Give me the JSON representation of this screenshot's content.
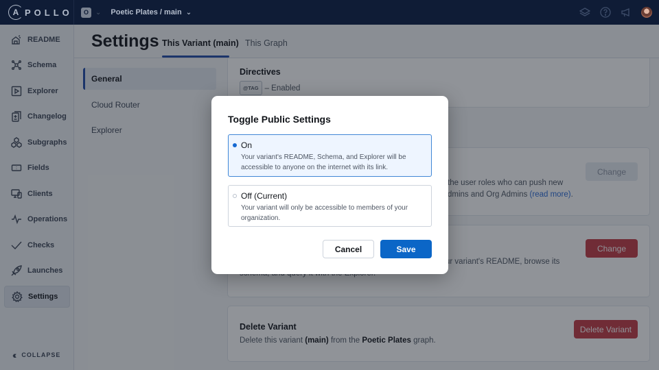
{
  "topbar": {
    "logo": "APOLLO",
    "org_badge": "O",
    "graph_variant": "Poetic Plates / main",
    "icons": [
      "layers-icon",
      "help-icon",
      "megaphone-icon",
      "user-avatar"
    ]
  },
  "sidebar": {
    "items": [
      {
        "label": "README",
        "icon": "readme-icon"
      },
      {
        "label": "Schema",
        "icon": "schema-icon"
      },
      {
        "label": "Explorer",
        "icon": "explorer-icon"
      },
      {
        "label": "Changelog",
        "icon": "changelog-icon"
      },
      {
        "label": "Subgraphs",
        "icon": "subgraphs-icon"
      },
      {
        "label": "Fields",
        "icon": "fields-icon"
      },
      {
        "label": "Clients",
        "icon": "clients-icon"
      },
      {
        "label": "Operations",
        "icon": "operations-icon"
      },
      {
        "label": "Checks",
        "icon": "checks-icon"
      },
      {
        "label": "Launches",
        "icon": "launches-icon"
      },
      {
        "label": "Settings",
        "icon": "gear-icon",
        "active": true
      }
    ],
    "collapse_label": "COLLAPSE"
  },
  "header": {
    "title": "Settings",
    "tabs": [
      {
        "label": "This Variant (main)",
        "active": true
      },
      {
        "label": "This Graph",
        "active": false
      }
    ]
  },
  "subnav": {
    "items": [
      {
        "label": "General",
        "active": true
      },
      {
        "label": "Cloud Router",
        "active": false
      },
      {
        "label": "Explorer",
        "active": false
      }
    ]
  },
  "cards": {
    "directives": {
      "title": "Directives",
      "tag": "@TAG",
      "status": "– Enabled"
    },
    "protected": {
      "text_line1": "the user roles who can push new",
      "text_line2_prefix": "dmins and Org Admins ",
      "link": "(read more)",
      "text_line2_suffix": ".",
      "button": "Change"
    },
    "public": {
      "text_line1": "ur variant's README, browse its",
      "text_line2": "schema, and query it with the Explorer.",
      "button": "Change"
    },
    "delete": {
      "title": "Delete Variant",
      "text_prefix": "Delete this variant ",
      "variant": "(main)",
      "text_mid": " from the ",
      "graph": "Poetic Plates",
      "text_suffix": " graph.",
      "button": "Delete Variant"
    }
  },
  "modal": {
    "title": "Toggle Public Settings",
    "options": [
      {
        "label": "On",
        "description": "Your variant's README, Schema, and Explorer will be accessible to anyone on the internet with its link.",
        "selected": true
      },
      {
        "label": "Off (Current)",
        "description": "Your variant will only be accessible to members of your organization.",
        "selected": false
      }
    ],
    "cancel_label": "Cancel",
    "save_label": "Save"
  },
  "colors": {
    "nav_bg": "#0f1c36",
    "primary": "#0b66c7",
    "danger": "#c23a44",
    "accent_tab": "#1f4aa8"
  }
}
